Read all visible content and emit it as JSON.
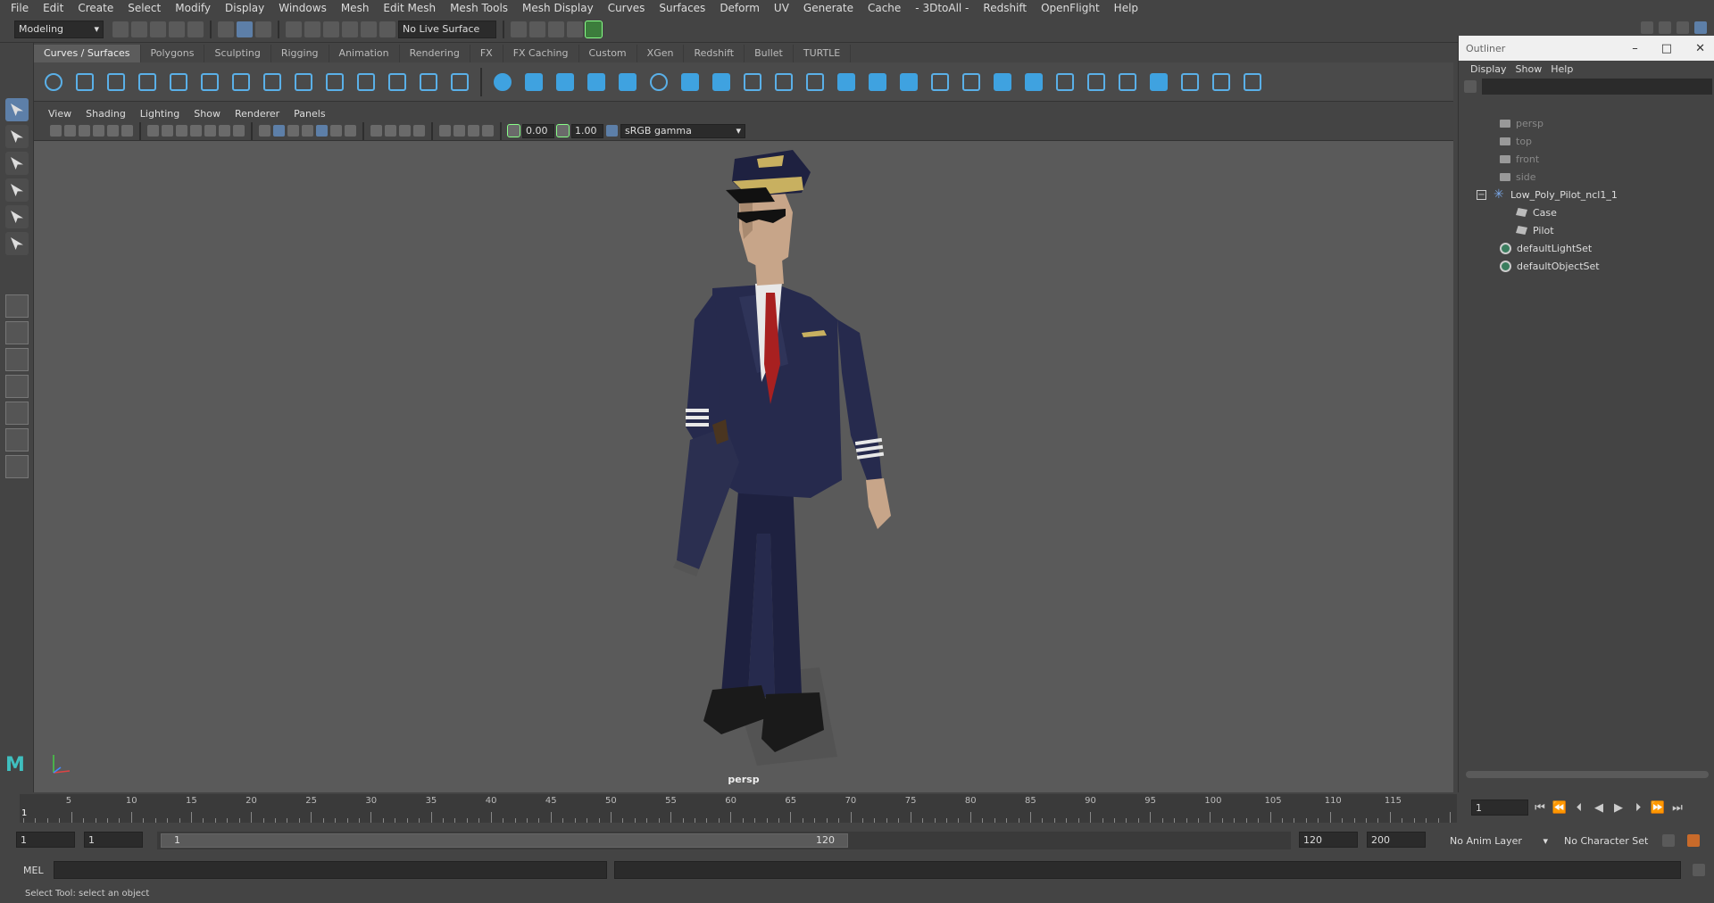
{
  "menus": [
    "File",
    "Edit",
    "Create",
    "Select",
    "Modify",
    "Display",
    "Windows",
    "Mesh",
    "Edit Mesh",
    "Mesh Tools",
    "Mesh Display",
    "Curves",
    "Surfaces",
    "Deform",
    "UV",
    "Generate",
    "Cache",
    "- 3DtoAll -",
    "Redshift",
    "OpenFlight",
    "Help"
  ],
  "status_line": {
    "mode": "Modeling",
    "live_surface": "No Live Surface"
  },
  "shelf_tabs": [
    "Curves / Surfaces",
    "Polygons",
    "Sculpting",
    "Rigging",
    "Animation",
    "Rendering",
    "FX",
    "FX Caching",
    "Custom",
    "XGen",
    "Redshift",
    "Bullet",
    "TURTLE"
  ],
  "active_shelf_tab": "Curves / Surfaces",
  "viewport": {
    "menus": [
      "View",
      "Shading",
      "Lighting",
      "Show",
      "Renderer",
      "Panels"
    ],
    "exposure": "0.00",
    "gamma_value": "1.00",
    "color_space": "sRGB gamma",
    "camera_label": "persp"
  },
  "outliner": {
    "title": "Outliner",
    "menus": [
      "Display",
      "Show",
      "Help"
    ],
    "items": [
      {
        "label": "persp",
        "kind": "camera"
      },
      {
        "label": "top",
        "kind": "camera"
      },
      {
        "label": "front",
        "kind": "camera"
      },
      {
        "label": "side",
        "kind": "camera"
      },
      {
        "label": "Low_Poly_Pilot_ncl1_1",
        "kind": "group"
      },
      {
        "label": "Case",
        "kind": "mesh"
      },
      {
        "label": "Pilot",
        "kind": "mesh"
      },
      {
        "label": "defaultLightSet",
        "kind": "set"
      },
      {
        "label": "defaultObjectSet",
        "kind": "set"
      }
    ]
  },
  "timeline": {
    "ticks": [
      "5",
      "10",
      "15",
      "20",
      "25",
      "30",
      "35",
      "40",
      "45",
      "50",
      "55",
      "60",
      "65",
      "70",
      "75",
      "80",
      "85",
      "90",
      "95",
      "100",
      "105",
      "110",
      "115"
    ],
    "current_frame_marker": "1",
    "current_frame": "1"
  },
  "range": {
    "start": "1",
    "playback_start": "1",
    "range_start_label": "1",
    "range_end_label": "120",
    "playback_end": "120",
    "end": "200",
    "anim_layer": "No Anim Layer",
    "character_set": "No Character Set"
  },
  "command_line": {
    "label": "MEL"
  },
  "help_line": "Select Tool: select an object",
  "colors": {
    "accent": "#5d7fa8",
    "shelf_icon": "#3fa2e0",
    "viewport_bg": "#5a5a5a"
  }
}
